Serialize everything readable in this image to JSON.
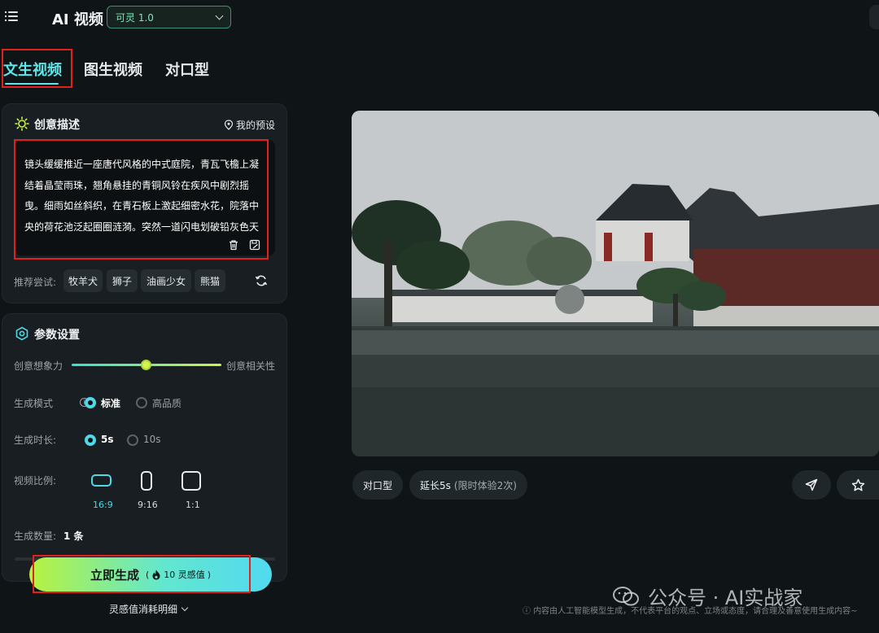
{
  "header": {
    "app_title": "AI 视频",
    "model_select": "可灵 1.0"
  },
  "tabs": [
    {
      "label": "文生视频",
      "active": true
    },
    {
      "label": "图生视频",
      "active": false
    },
    {
      "label": "对口型",
      "active": false
    }
  ],
  "prompt_panel": {
    "title": "创意描述",
    "preset_label": "我的预设",
    "prompt_text": "镜头缓缓推近一座唐代风格的中式庭院，青瓦飞檐上凝结着晶莹雨珠，翘角悬挂的青铜风铃在疾风中剧烈摇曳。细雨如丝斜织，在青石板上激起细密水花，院落中央的荷花池泛起圈圈涟漪。突然一道闪电划破铅灰色天",
    "suggest_label": "推荐尝试:",
    "suggestions": [
      "牧羊犬",
      "狮子",
      "油画少女",
      "熊猫"
    ]
  },
  "params_panel": {
    "title": "参数设置",
    "slider_left": "创意想象力",
    "slider_right": "创意相关性",
    "slider_value": 0.5,
    "mode_label": "生成模式",
    "mode_options": [
      {
        "label": "标准",
        "selected": true
      },
      {
        "label": "高品质",
        "selected": false
      }
    ],
    "duration_label": "生成时长:",
    "duration_options": [
      {
        "label": "5s",
        "selected": true
      },
      {
        "label": "10s",
        "selected": false
      }
    ],
    "ratio_label": "视频比例:",
    "ratios": [
      {
        "label": "16:9",
        "selected": true
      },
      {
        "label": "9:16",
        "selected": false
      },
      {
        "label": "1:1",
        "selected": false
      }
    ],
    "count_label": "生成数量:",
    "count_value": "1 条"
  },
  "generate": {
    "label": "立即生成",
    "cost": "10 灵感值"
  },
  "bottom_link": "灵感值消耗明细",
  "video_actions": {
    "lip_sync": "对口型",
    "extend": "延长5s",
    "extend_note": "(限时体验2次)"
  },
  "disclaimer": "内容由人工智能模型生成，不代表平台的观点、立场或态度，请合理及善意使用生成内容~",
  "watermark": "公众号 · AI实战家",
  "colors": {
    "accent": "#5fe6ea",
    "highlight_box": "#e0221c",
    "background": "#0f1417"
  }
}
